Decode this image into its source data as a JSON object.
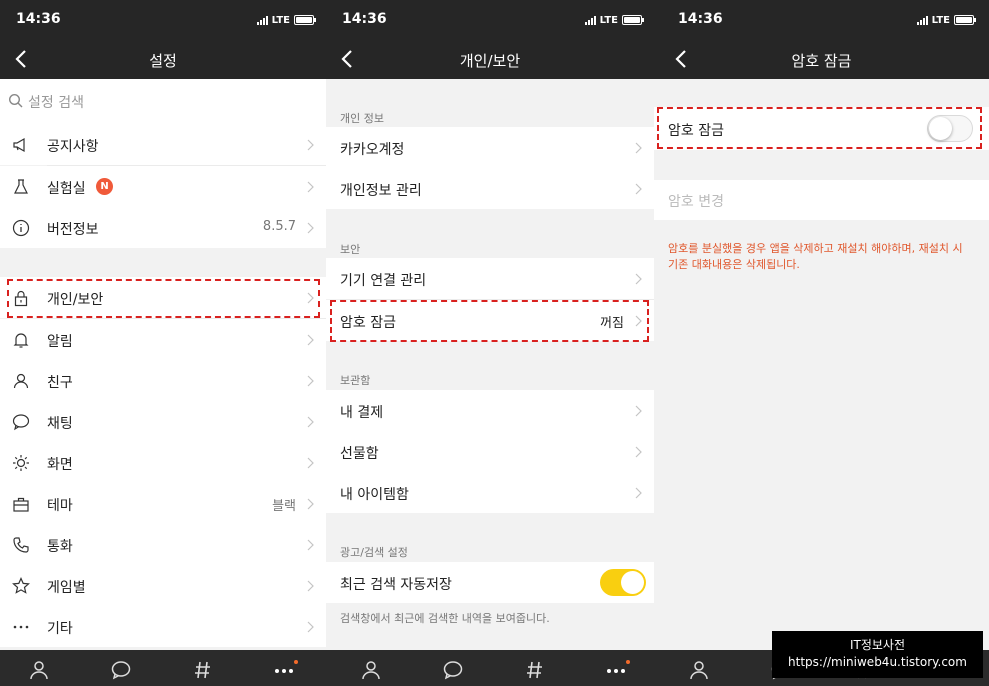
{
  "status": {
    "time": "14:36",
    "network": "LTE"
  },
  "panel1": {
    "title": "설정",
    "search_placeholder": "설정 검색",
    "group1": [
      {
        "label": "공지사항",
        "icon": "megaphone-icon"
      },
      {
        "label": "실험실",
        "icon": "flask-icon",
        "badge": "N"
      },
      {
        "label": "버전정보",
        "icon": "info-icon",
        "value": "8.5.7"
      }
    ],
    "group2": [
      {
        "label": "개인/보안",
        "icon": "lock-icon"
      },
      {
        "label": "알림",
        "icon": "bell-icon"
      },
      {
        "label": "친구",
        "icon": "person-icon"
      },
      {
        "label": "채팅",
        "icon": "chat-bubble-icon"
      },
      {
        "label": "화면",
        "icon": "sun-icon"
      },
      {
        "label": "테마",
        "icon": "briefcase-icon",
        "value": "블랙"
      },
      {
        "label": "통화",
        "icon": "phone-icon"
      },
      {
        "label": "게임별",
        "icon": "star-icon"
      },
      {
        "label": "기타",
        "icon": "more-icon"
      }
    ]
  },
  "panel2": {
    "title": "개인/보안",
    "sections": {
      "personal": "개인 정보",
      "security": "보안",
      "storage": "보관함",
      "ad_search": "광고/검색 설정"
    },
    "personal_rows": [
      "카카오계정",
      "개인정보 관리"
    ],
    "security_rows": [
      {
        "label": "기기 연결 관리"
      },
      {
        "label": "암호 잠금",
        "value": "꺼짐"
      }
    ],
    "storage_rows": [
      "내 결제",
      "선물함",
      "내 아이템함"
    ],
    "auto_save": {
      "label": "최근 검색 자동저장",
      "enabled": true
    },
    "auto_save_note": "검색창에서 최근에 검색한 내역을 보여줍니다."
  },
  "panel3": {
    "title": "암호 잠금",
    "lock_label": "암호 잠금",
    "lock_enabled": false,
    "change_label": "암호 변경",
    "warning_line1": "암호를 분실했을 경우 앱을 삭제하고 재설치 해야하며, 재설치 시",
    "warning_line2": "기존 대화내용은 삭제됩니다."
  },
  "watermark": {
    "line1": "IT정보사전",
    "line2": "https://miniweb4u.tistory.com"
  },
  "colors": {
    "nav": "#262626",
    "accent_yellow": "#f9cf10",
    "highlight": "#d9211f",
    "warning": "#e0572c",
    "badge": "#f05a3a"
  }
}
